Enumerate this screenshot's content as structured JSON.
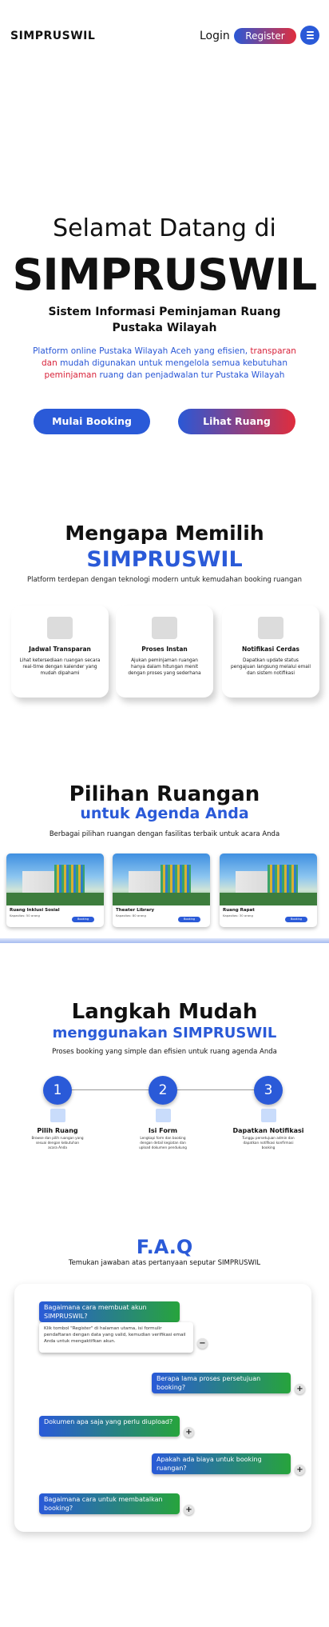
{
  "header": {
    "logo": "SIMPRUSWIL",
    "login_label": "Login",
    "register_label": "Register",
    "menu_icon": "hamburger-menu-icon"
  },
  "hero": {
    "title_top": "Selamat Datang di",
    "title_main": "SIMPRUSWIL",
    "subtitle": "Sistem Informasi Peminjaman Ruang Pustaka Wilayah",
    "desc_a": "Platform online Pustaka Wilayah Aceh yang efisien, ",
    "desc_b": "transparan dan",
    "desc_c": " mudah digunakan untuk mengelola semua kebutuhan ",
    "desc_d": "peminjaman",
    "desc_e": " ruang dan penjadwalan tur Pustaka Wilayah",
    "btn_booking": "Mulai Booking",
    "btn_rooms": "Lihat Ruang"
  },
  "why": {
    "title1": "Mengapa Memilih",
    "title2": "SIMPRUSWIL",
    "desc": "Platform terdepan dengan teknologi modern untuk kemudahan booking ruangan",
    "features": [
      {
        "title": "Jadwal Transparan",
        "desc": "Lihat ketersediaan ruangan secara real-time dengan kalender yang mudah dipahami"
      },
      {
        "title": "Proses Instan",
        "desc": "Ajukan peminjaman ruangan hanya dalam hitungan menit dengan proses yang sederhana"
      },
      {
        "title": "Notifikasi Cerdas",
        "desc": "Dapatkan update status pengajuan langsung melalui email dan sistem notifikasi"
      }
    ]
  },
  "rooms": {
    "title1": "Pilihan Ruangan",
    "title2": "untuk Agenda Anda",
    "desc": "Berbagai pilihan ruangan dengan fasilitas terbaik untuk acara Anda",
    "cards": [
      {
        "name": "Ruang Inklusi Sosial",
        "caption": "Kapasitas: 50 orang",
        "button": "Booking"
      },
      {
        "name": "Theater Library",
        "caption": "Kapasitas: 80 orang",
        "button": "Booking"
      },
      {
        "name": "Ruang Rapat",
        "caption": "Kapasitas: 30 orang",
        "button": "Booking"
      }
    ]
  },
  "steps": {
    "title1": "Langkah Mudah",
    "title2": "menggunakan SIMPRUSWIL",
    "desc": "Proses booking yang simple dan efisien untuk ruang agenda Anda",
    "items": [
      {
        "num": "1",
        "title": "Pilih Ruang",
        "desc": "Browse dan pilih ruangan yang sesuai dengan kebutuhan acara Anda"
      },
      {
        "num": "2",
        "title": "Isi Form",
        "desc": "Lengkapi form dan booking dengan detail kegiatan dan upload dokumen pendukung"
      },
      {
        "num": "3",
        "title": "Dapatkan Notifikasi",
        "desc": "Tunggu persetujuan admin dan dapatkan notifikasi konfirmasi booking"
      }
    ]
  },
  "faq": {
    "title": "F.A.Q",
    "desc": "Temukan jawaban atas pertanyaan seputar SIMPRUSWIL",
    "items": [
      {
        "q": "Bagaimana cara membuat akun SIMPRUSWIL?",
        "a": "Klik tombol \"Register\" di halaman utama, isi formulir pendaftaran dengan data yang valid, kemudian verifikasi email Anda untuk mengaktifkan akun.",
        "toggle": "−"
      },
      {
        "q": "Berapa lama proses persetujuan booking?",
        "toggle": "+"
      },
      {
        "q": "Dokumen apa saja yang perlu diupload?",
        "toggle": "+"
      },
      {
        "q": "Apakah ada biaya untuk booking ruangan?",
        "toggle": "+"
      },
      {
        "q": "Bagaimana cara untuk membatalkan booking?",
        "toggle": "+"
      }
    ]
  }
}
